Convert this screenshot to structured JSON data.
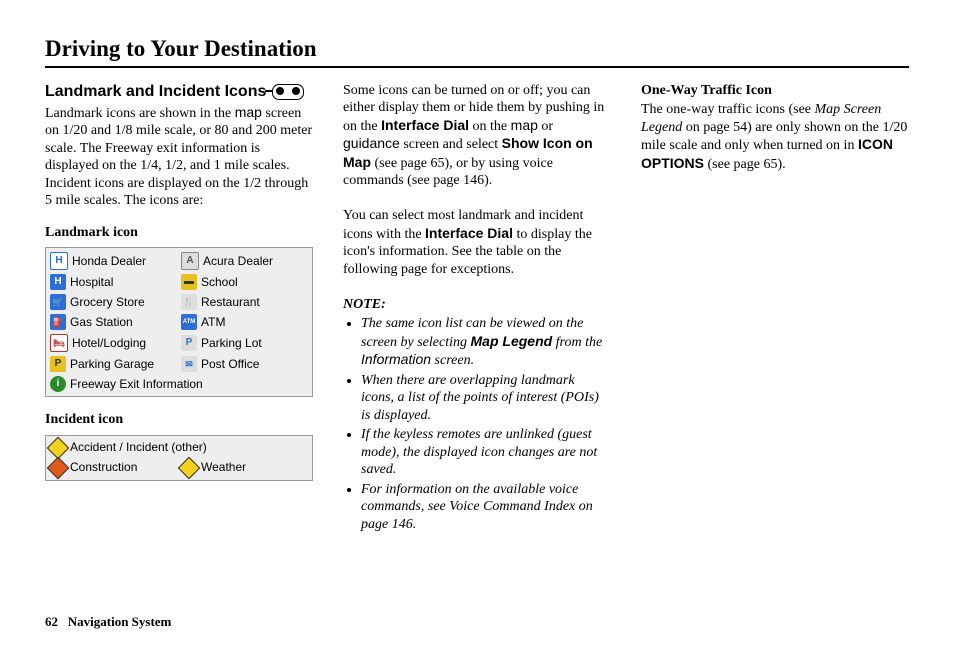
{
  "page_title": "Driving to Your Destination",
  "footer": {
    "page_number": "62",
    "section": "Navigation System"
  },
  "col1": {
    "heading": "Landmark and Incident Icons",
    "intro_parts": [
      "Landmark icons are shown in the ",
      "map",
      " screen on 1/20 and 1/8 mile scale, or 80 and 200 meter scale. The Freeway exit information is displayed on the 1/4, 1/2, and 1 mile scales. Incident icons are displayed on the 1/2 through 5 mile scales. The icons are:"
    ],
    "landmark_heading": "Landmark icon",
    "landmark_rows": [
      [
        {
          "icon": "honda",
          "label": "Honda Dealer"
        },
        {
          "icon": "acura",
          "label": "Acura Dealer"
        }
      ],
      [
        {
          "icon": "hospital",
          "label": "Hospital"
        },
        {
          "icon": "school",
          "label": "School"
        }
      ],
      [
        {
          "icon": "grocery",
          "label": "Grocery Store"
        },
        {
          "icon": "restaurant",
          "label": "Restaurant"
        }
      ],
      [
        {
          "icon": "gas",
          "label": "Gas Station"
        },
        {
          "icon": "atm",
          "label": "ATM"
        }
      ],
      [
        {
          "icon": "hotel",
          "label": "Hotel/Lodging"
        },
        {
          "icon": "parkinglot",
          "label": "Parking Lot"
        }
      ],
      [
        {
          "icon": "garage",
          "label": "Parking Garage"
        },
        {
          "icon": "post",
          "label": "Post Office"
        }
      ],
      [
        {
          "icon": "freeway",
          "label": "Freeway Exit Information",
          "full": true
        }
      ]
    ],
    "incident_heading": "Incident icon",
    "incident_rows": [
      [
        {
          "icon": "accident",
          "label": "Accident / Incident (other)",
          "full": true
        }
      ],
      [
        {
          "icon": "construction",
          "label": "Construction"
        },
        {
          "icon": "weather",
          "label": "Weather"
        }
      ]
    ]
  },
  "col2": {
    "para1_parts": [
      "Some icons can be turned on or off; you can either display them or hide them by pushing in on the ",
      {
        "b": true,
        "sans": true,
        "t": "Interface Dial"
      },
      " on the ",
      {
        "sans": true,
        "t": "map"
      },
      " or ",
      {
        "sans": true,
        "t": "guidance"
      },
      " screen and select ",
      {
        "b": true,
        "sans": true,
        "t": "Show Icon on Map"
      },
      " (see page 65), or by using voice commands (see page 146)."
    ],
    "para2_parts": [
      "You can select most landmark and incident icons with the ",
      {
        "b": true,
        "sans": true,
        "t": "Interface Dial"
      },
      " to display the icon's information. See the table on the following page for exceptions."
    ],
    "note_label": "NOTE:",
    "notes": [
      [
        {
          "i": true,
          "t": "The same icon list can be viewed on the screen by selecting "
        },
        {
          "b": true,
          "sans": true,
          "t": "Map Legend"
        },
        {
          "i": true,
          "t": " from the "
        },
        {
          "sans": true,
          "t": "Information"
        },
        {
          "i": true,
          "t": " screen."
        }
      ],
      [
        {
          "i": true,
          "t": "When there are overlapping landmark icons, a list of the points of interest (POIs) is displayed."
        }
      ],
      [
        {
          "i": true,
          "t": "If the keyless remotes are unlinked (guest mode), the displayed icon changes are not saved."
        }
      ],
      [
        {
          "i": true,
          "t": "For information on the available voice commands, "
        },
        {
          "t": "see "
        },
        {
          "i": true,
          "t": "Voice Command Index"
        },
        {
          "i": true,
          "t": " on page 146."
        }
      ]
    ]
  },
  "col3": {
    "heading": "One-Way Traffic Icon",
    "para_parts": [
      "The one-way traffic icons (see ",
      {
        "i": true,
        "t": "Map Screen Legend"
      },
      " on page 54) are only shown on the 1/20 mile scale and only when turned on in ",
      {
        "b": true,
        "sans": true,
        "t": "ICON OPTIONS"
      },
      " (see page 65)."
    ]
  }
}
